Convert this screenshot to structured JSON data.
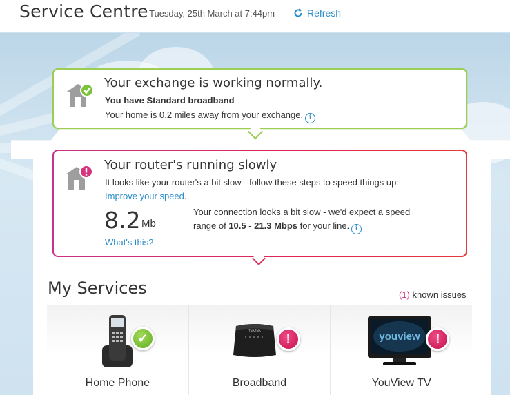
{
  "header": {
    "title": "Service Centre",
    "date": "Tuesday, 25th March at 7:44pm",
    "refresh_label": "Refresh"
  },
  "exchange_card": {
    "heading": "Your exchange is working normally.",
    "line1": "You have Standard broadband",
    "line2": "Your home is 0.2 miles away from your exchange."
  },
  "router_card": {
    "heading": "Your router's running slowly",
    "line1": "It looks like your router's a bit slow - follow these steps to speed things up:",
    "link": "Improve your speed",
    "link_suffix": ".",
    "speed_value": "8.2",
    "speed_unit": "Mb",
    "whats_this": "What's this?",
    "desc_part1": "Your connection looks a bit slow - we'd expect a speed",
    "desc_part2": "range of ",
    "desc_range": "10.5 - 21.3 Mbps",
    "desc_part3": " for your line."
  },
  "services": {
    "title": "My Services",
    "issues_count": "(1)",
    "issues_label": " known issues",
    "items": [
      {
        "label": "Home Phone",
        "status": "ok"
      },
      {
        "label": "Broadband",
        "status": "issue"
      },
      {
        "label": "YouView TV",
        "status": "issue"
      }
    ]
  },
  "device_text": {
    "router_brand": "TalkTalk",
    "tv_brand": "youview"
  },
  "colors": {
    "accent_blue": "#2a8dc8",
    "ok_green": "#7cc23a",
    "alert_pink": "#d6337f"
  }
}
